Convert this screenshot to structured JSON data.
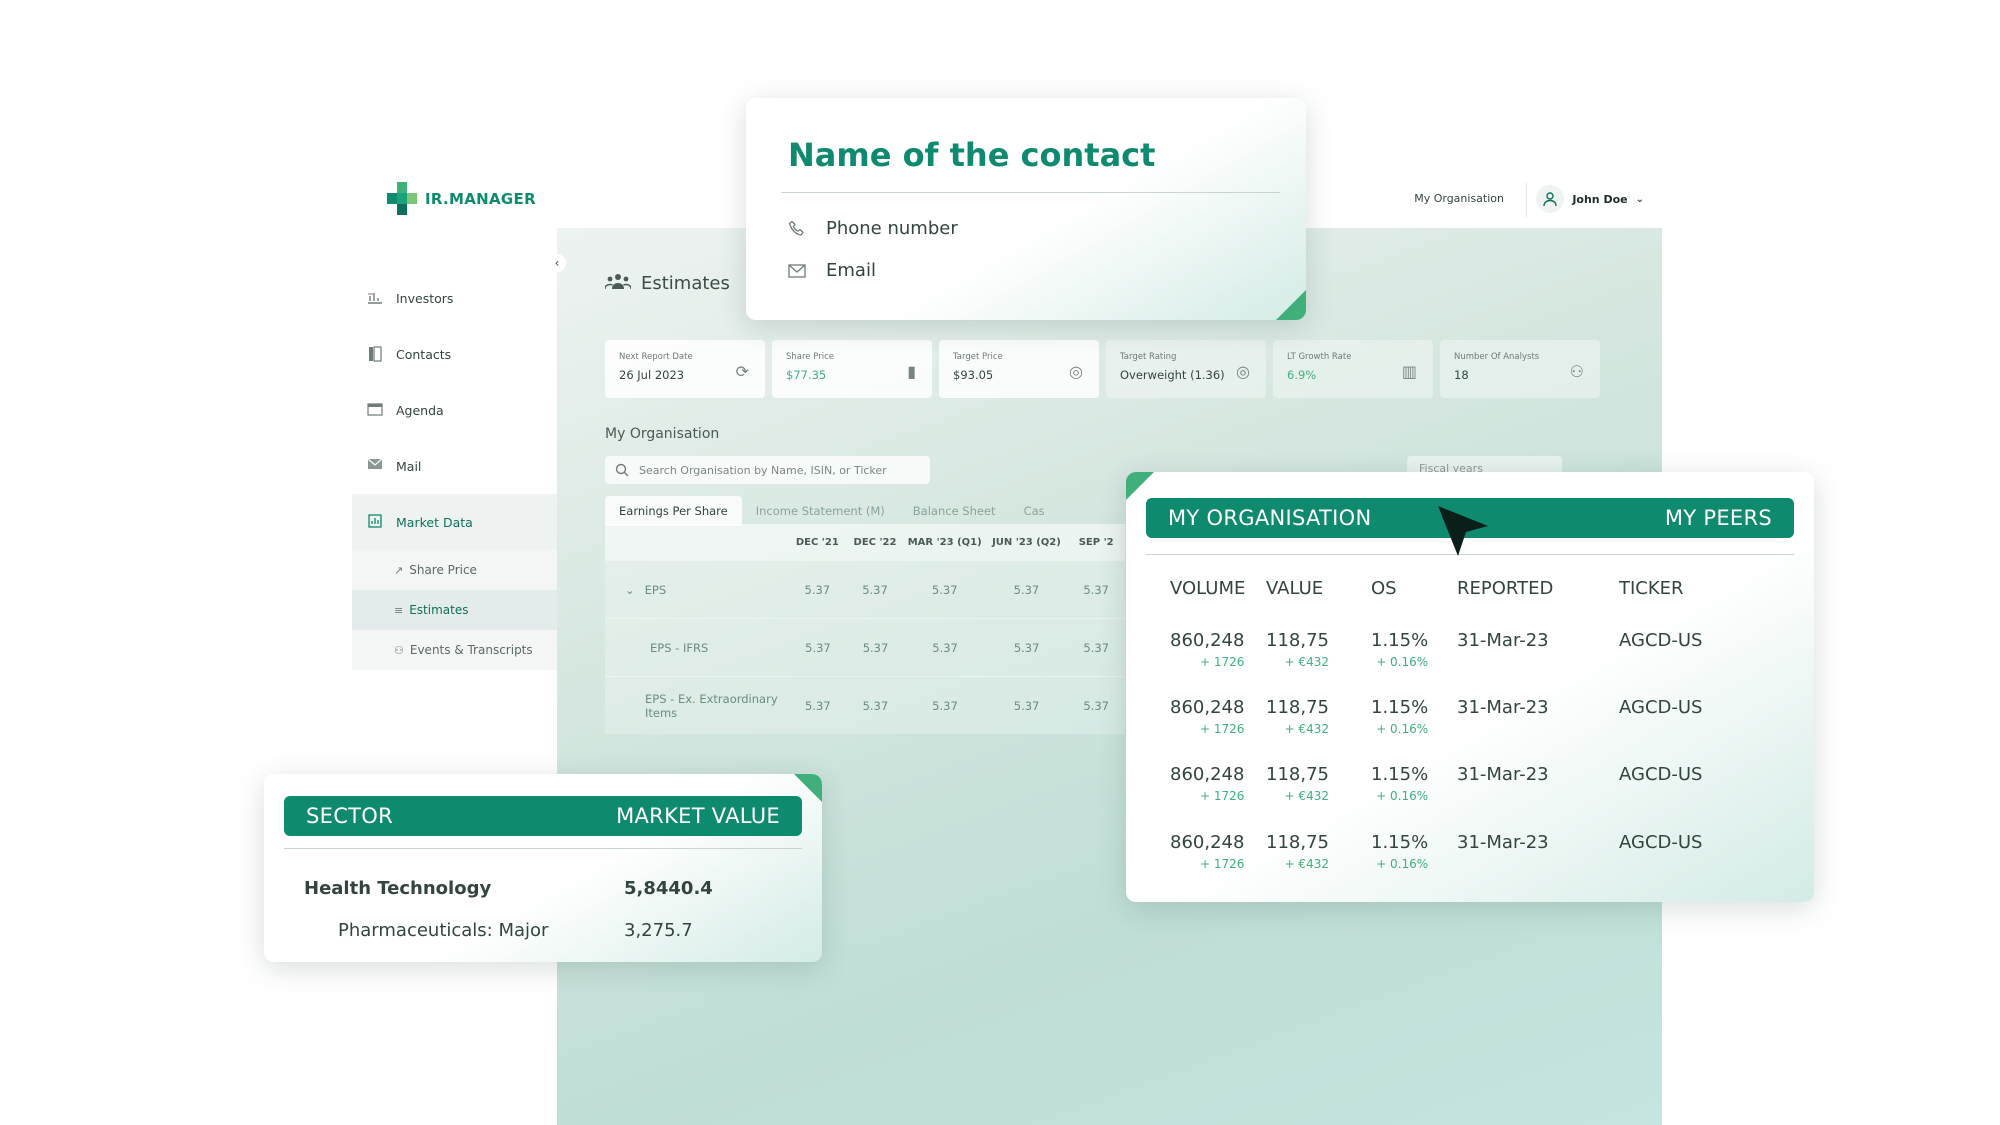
{
  "app": {
    "logo_text": "IR.MANAGER",
    "topbar": {
      "org_label": "My Organisation",
      "user_name": "John Doe"
    },
    "nav": [
      {
        "label": "Investors",
        "icon": "chart-icon"
      },
      {
        "label": "Contacts",
        "icon": "contacts-icon"
      },
      {
        "label": "Agenda",
        "icon": "calendar-icon"
      },
      {
        "label": "Mail",
        "icon": "mail-icon"
      },
      {
        "label": "Market Data",
        "icon": "market-icon"
      }
    ],
    "subnav": [
      {
        "label": "Share Price",
        "icon": "trend-icon"
      },
      {
        "label": "Estimates",
        "icon": "estimates-icon"
      },
      {
        "label": "Events & Transcripts",
        "icon": "events-icon"
      }
    ],
    "page_title": "Estimates",
    "kpis": [
      {
        "label": "Next Report Date",
        "value": "26 Jul 2023"
      },
      {
        "label": "Share Price",
        "value": "$77.35"
      },
      {
        "label": "Target Price",
        "value": "$93.05"
      },
      {
        "label": "Target Rating",
        "value": "Overweight (1.36)"
      },
      {
        "label": "LT Growth Rate",
        "value": "6.9%"
      },
      {
        "label": "Number Of Analysts",
        "value": "18"
      }
    ],
    "section_title": "My Organisation",
    "search_placeholder": "Search Organisation by Name, ISIN, or Ticker",
    "fiscal_label": "Fiscal years",
    "tabs": [
      "Earnings Per Share",
      "Income Statement (M)",
      "Balance Sheet",
      "Cas"
    ],
    "grid": {
      "columns": [
        "DEC '21",
        "DEC '22",
        "MAR '23 (Q1)",
        "JUN '23 (Q2)",
        "SEP '2"
      ],
      "rows": [
        {
          "label": "EPS",
          "values": [
            "5.37",
            "5.37",
            "5.37",
            "5.37",
            "5.37"
          ]
        },
        {
          "label": "EPS - IFRS",
          "values": [
            "5.37",
            "5.37",
            "5.37",
            "5.37",
            "5.37"
          ]
        },
        {
          "label": "EPS - Ex. Extraordinary Items",
          "values": [
            "5.37",
            "5.37",
            "5.37",
            "5.37",
            "5.37"
          ]
        }
      ]
    }
  },
  "contact_card": {
    "name": "Name of the contact",
    "phone": "Phone number",
    "email": "Email"
  },
  "sector_card": {
    "header_left": "SECTOR",
    "header_right": "MARKET VALUE",
    "rows": [
      {
        "sector": "Health Technology",
        "value": "5,8440.4"
      },
      {
        "sector": "Pharmaceuticals: Major",
        "value": "3,275.7"
      }
    ]
  },
  "org_card": {
    "header_left": "MY ORGANISATION",
    "header_right": "MY PEERS",
    "columns": [
      "VOLUME",
      "VALUE",
      "OS",
      "REPORTED",
      "TICKER"
    ],
    "rows": [
      {
        "volume": "860,248",
        "volume_delta": "+ 1726",
        "value": "118,75",
        "value_delta": "+ €432",
        "os": "1.15%",
        "os_delta": "+ 0.16%",
        "reported": "31-Mar-23",
        "ticker": "AGCD-US"
      },
      {
        "volume": "860,248",
        "volume_delta": "+ 1726",
        "value": "118,75",
        "value_delta": "+ €432",
        "os": "1.15%",
        "os_delta": "+ 0.16%",
        "reported": "31-Mar-23",
        "ticker": "AGCD-US"
      },
      {
        "volume": "860,248",
        "volume_delta": "+ 1726",
        "value": "118,75",
        "value_delta": "+ €432",
        "os": "1.15%",
        "os_delta": "+ 0.16%",
        "reported": "31-Mar-23",
        "ticker": "AGCD-US"
      },
      {
        "volume": "860,248",
        "volume_delta": "+ 1726",
        "value": "118,75",
        "value_delta": "+ €432",
        "os": "1.15%",
        "os_delta": "+ 0.16%",
        "reported": "31-Mar-23",
        "ticker": "AGCD-US"
      }
    ]
  },
  "colors": {
    "brand_green": "#0e8a6f",
    "accent_green": "#3fb07c",
    "text_dark": "#33443d"
  }
}
